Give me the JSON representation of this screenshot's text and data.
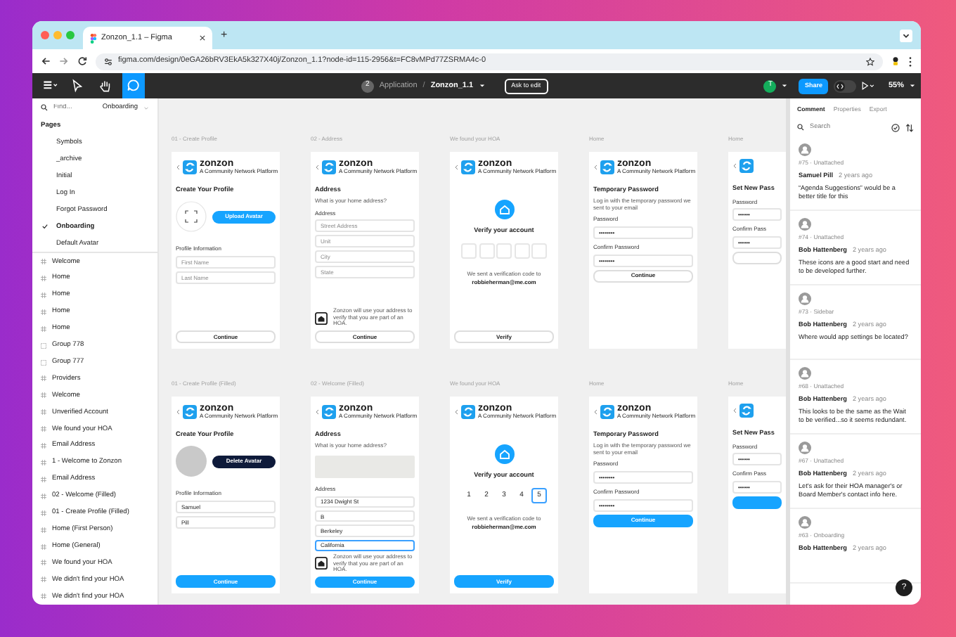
{
  "browser": {
    "tab_title": "Zonzon_1.1 – Figma",
    "new_tab": "+",
    "url": "figma.com/design/0eGA26bRV3EkA5k327X40j/Zonzon_1.1?node-id=115-2956&t=FC8vMPd77ZSRMA4c-0"
  },
  "toolbar": {
    "tools": [
      {
        "kind": "menu",
        "selected": false
      },
      {
        "kind": "move",
        "selected": false
      },
      {
        "kind": "hand",
        "selected": false
      },
      {
        "kind": "comment",
        "selected": true
      }
    ],
    "badge": "2",
    "project": "Application",
    "separator": "/",
    "file": "Zonzon_1.1",
    "ask_button": "Ask to edit",
    "user_initial": "T",
    "share": "Share",
    "zoom": "55%"
  },
  "sidebar": {
    "search": {
      "placeholder": "Find..."
    },
    "page_select": "Onboarding",
    "pages_heading": "Pages",
    "pages": [
      {
        "label": "Symbols",
        "selected": false
      },
      {
        "label": "_archive",
        "selected": false
      },
      {
        "label": "Initial",
        "selected": false
      },
      {
        "label": "Log In",
        "selected": false
      },
      {
        "label": "Forgot Password",
        "selected": false
      },
      {
        "label": "Onboarding",
        "selected": true
      },
      {
        "label": "Default Avatar",
        "selected": false
      }
    ],
    "layers": [
      {
        "label": "Welcome",
        "kind": "frame"
      },
      {
        "label": "Home",
        "kind": "frame"
      },
      {
        "label": "Home",
        "kind": "frame"
      },
      {
        "label": "Home",
        "kind": "frame"
      },
      {
        "label": "Home",
        "kind": "frame"
      },
      {
        "label": "Group 778",
        "kind": "group"
      },
      {
        "label": "Group 777",
        "kind": "group"
      },
      {
        "label": "Providers",
        "kind": "frame"
      },
      {
        "label": "Welcome",
        "kind": "frame"
      },
      {
        "label": "Unverified Account",
        "kind": "frame"
      },
      {
        "label": "We found your HOA",
        "kind": "frame"
      },
      {
        "label": "Email Address",
        "kind": "frame"
      },
      {
        "label": "1 - Welcome to Zonzon",
        "kind": "frame"
      },
      {
        "label": "Email Address",
        "kind": "frame"
      },
      {
        "label": "02 - Welcome (Filled)",
        "kind": "frame"
      },
      {
        "label": "01 - Create Profile (Filled)",
        "kind": "frame"
      },
      {
        "label": "Home (First Person)",
        "kind": "frame"
      },
      {
        "label": "Home (General)",
        "kind": "frame"
      },
      {
        "label": "We found your HOA",
        "kind": "frame"
      },
      {
        "label": "We didn't find your HOA",
        "kind": "frame"
      },
      {
        "label": "We didn't find your HOA",
        "kind": "frame"
      }
    ]
  },
  "canvas": {
    "frames": [
      {
        "label": "01 - Create Profile",
        "blocks": [
          {
            "kind": "logo",
            "name": "zonzon",
            "tagline": "A Community Network Platform"
          },
          {
            "kind": "title",
            "text": "Create Your Profile"
          },
          {
            "kind": "avatar",
            "photo": false,
            "button": "Upload Avatar",
            "dark": false
          },
          {
            "kind": "label",
            "text": "Profile Information"
          },
          {
            "kind": "field",
            "placeholder": "First Name",
            "focused": false
          },
          {
            "kind": "field",
            "placeholder": "Last Name",
            "focused": false
          },
          {
            "kind": "button",
            "text": "Continue",
            "filled": false,
            "bottom": true
          }
        ]
      },
      {
        "label": "02 - Address",
        "blocks": [
          {
            "kind": "logo",
            "name": "zonzon",
            "tagline": "A Community Network Platform"
          },
          {
            "kind": "title",
            "text": "Address"
          },
          {
            "kind": "sub",
            "text": "What is your home address?"
          },
          {
            "kind": "label",
            "text": "Address"
          },
          {
            "kind": "field",
            "placeholder": "Street Address",
            "focused": false
          },
          {
            "kind": "field",
            "placeholder": "Unit",
            "focused": false
          },
          {
            "kind": "field",
            "placeholder": "City",
            "focused": false
          },
          {
            "kind": "field",
            "placeholder": "State",
            "focused": false
          },
          {
            "kind": "note",
            "text": "Zonzon will use your address to verify that you are part of an HOA.",
            "bottom": true
          },
          {
            "kind": "button",
            "text": "Continue",
            "filled": false
          }
        ]
      },
      {
        "label": "We found your HOA",
        "blocks": [
          {
            "kind": "logo",
            "name": "zonzon",
            "tagline": "A Community Network Platform"
          },
          {
            "kind": "home"
          },
          {
            "kind": "heading",
            "text": "Verify your account"
          },
          {
            "kind": "code",
            "boxes": [
              {
                "selected": false
              },
              {
                "selected": false
              },
              {
                "selected": false
              },
              {
                "selected": false
              },
              {
                "selected": false
              }
            ]
          },
          {
            "kind": "sent",
            "text": "We sent a verification code to",
            "email": "robbieherman@me.com"
          },
          {
            "kind": "button",
            "text": "Verify",
            "filled": false,
            "bottom": true
          }
        ]
      },
      {
        "label": "Home",
        "blocks": [
          {
            "kind": "logo",
            "name": "zonzon",
            "tagline": "A Community Network Platform"
          },
          {
            "kind": "title",
            "text": "Temporary Password"
          },
          {
            "kind": "sub",
            "text": "Log in with the temporary password we sent to your email"
          },
          {
            "kind": "label",
            "text": "Password"
          },
          {
            "kind": "field",
            "value": "••••••••",
            "focused": false
          },
          {
            "kind": "label",
            "text": "Confirm Password"
          },
          {
            "kind": "field",
            "value": "••••••••",
            "focused": false
          },
          {
            "kind": "button",
            "text": "Continue",
            "filled": false
          }
        ]
      },
      {
        "label": "Home",
        "blocks": [
          {
            "kind": "logo"
          },
          {
            "kind": "title",
            "text": "Set New Pass"
          },
          {
            "kind": "label",
            "text": "Password"
          },
          {
            "kind": "field",
            "value": "••••••",
            "focused": false
          },
          {
            "kind": "label",
            "text": "Confirm Pass"
          },
          {
            "kind": "field",
            "value": "••••••",
            "focused": false
          },
          {
            "kind": "button",
            "filled": false
          }
        ]
      },
      {
        "label": "01 - Create Profile (Filled)",
        "blocks": [
          {
            "kind": "logo",
            "name": "zonzon",
            "tagline": "A Community Network Platform"
          },
          {
            "kind": "title",
            "text": "Create Your Profile"
          },
          {
            "kind": "avatar",
            "photo": true,
            "button": "Delete Avatar",
            "dark": true
          },
          {
            "kind": "label",
            "text": "Profile Information"
          },
          {
            "kind": "field",
            "value": "Samuel",
            "focused": false
          },
          {
            "kind": "field",
            "value": "Pill",
            "focused": false
          },
          {
            "kind": "button",
            "text": "Continue",
            "filled": true,
            "bottom": true
          }
        ]
      },
      {
        "label": "02 - Welcome (Filled)",
        "blocks": [
          {
            "kind": "logo",
            "name": "zonzon",
            "tagline": "A Community Network Platform"
          },
          {
            "kind": "title",
            "text": "Address"
          },
          {
            "kind": "sub",
            "text": "What is your home address?"
          },
          {
            "kind": "map"
          },
          {
            "kind": "label",
            "text": "Address"
          },
          {
            "kind": "field",
            "value": "1234 Dwight St",
            "focused": false
          },
          {
            "kind": "field",
            "value": "B",
            "focused": false
          },
          {
            "kind": "field",
            "value": "Berkeley",
            "focused": false
          },
          {
            "kind": "field",
            "value": "California",
            "focused": true
          },
          {
            "kind": "note",
            "text": "Zonzon will use your address to verify that you are part of an HOA."
          },
          {
            "kind": "button",
            "text": "Continue",
            "filled": true
          }
        ]
      },
      {
        "label": "We found your HOA",
        "blocks": [
          {
            "kind": "logo",
            "name": "zonzon",
            "tagline": "A Community Network Platform"
          },
          {
            "kind": "home"
          },
          {
            "kind": "heading",
            "text": "Verify your account"
          },
          {
            "kind": "code",
            "boxes": [
              {
                "text": "1",
                "selected": false
              },
              {
                "text": "2",
                "selected": false
              },
              {
                "text": "3",
                "selected": false
              },
              {
                "text": "4",
                "selected": false
              },
              {
                "text": "5",
                "selected": true
              }
            ]
          },
          {
            "kind": "sent",
            "text": "We sent a verification code to",
            "email": "robbieherman@me.com"
          },
          {
            "kind": "button",
            "text": "Verify",
            "filled": true,
            "bottom": true
          }
        ]
      },
      {
        "label": "Home",
        "blocks": [
          {
            "kind": "logo",
            "name": "zonzon",
            "tagline": "A Community Network Platform"
          },
          {
            "kind": "title",
            "text": "Temporary Password"
          },
          {
            "kind": "sub",
            "text": "Log in with the temporary password we sent to your email"
          },
          {
            "kind": "label",
            "text": "Password"
          },
          {
            "kind": "field",
            "value": "••••••••",
            "focused": false
          },
          {
            "kind": "label",
            "text": "Confirm Password"
          },
          {
            "kind": "field",
            "value": "••••••••",
            "focused": false
          },
          {
            "kind": "button",
            "text": "Continue",
            "filled": true
          }
        ]
      },
      {
        "label": "Home",
        "blocks": [
          {
            "kind": "logo"
          },
          {
            "kind": "title",
            "text": "Set New Pass"
          },
          {
            "kind": "label",
            "text": "Password"
          },
          {
            "kind": "field",
            "value": "••••••",
            "focused": false
          },
          {
            "kind": "label",
            "text": "Confirm Pass"
          },
          {
            "kind": "field",
            "value": "••••••",
            "focused": false
          },
          {
            "kind": "button",
            "filled": true
          }
        ]
      }
    ]
  },
  "panel": {
    "tabs": [
      {
        "label": "Comment",
        "selected": true
      },
      {
        "label": "Properties",
        "selected": false
      },
      {
        "label": "Export",
        "selected": false
      }
    ],
    "search": {
      "placeholder": "Search"
    },
    "comments": [
      {
        "meta": "#75 · Unattached",
        "author": "Samuel Pill",
        "time": "2 years ago",
        "text": "“Agenda Suggestions” would be a better title for this"
      },
      {
        "meta": "#74 · Unattached",
        "author": "Bob Hattenberg",
        "time": "2 years ago",
        "text": "These icons are a good start and need to be developed further."
      },
      {
        "meta": "#73 · Sidebar",
        "author": "Bob Hattenberg",
        "time": "2 years ago",
        "text": "Where would app settings be located?"
      },
      {
        "meta": "#68 · Unattached",
        "author": "Bob Hattenberg",
        "time": "2 years ago",
        "text": "This looks to be the same as the Wait to be verified...so it seems redundant."
      },
      {
        "meta": "#67 · Unattached",
        "author": "Bob Hattenberg",
        "time": "2 years ago",
        "text": "Let's ask for their HOA manager's or Board Member's contact info here."
      },
      {
        "meta": "#63 · Onboarding",
        "author": "Bob Hattenberg",
        "time": "2 years ago"
      }
    ],
    "help": "?"
  }
}
